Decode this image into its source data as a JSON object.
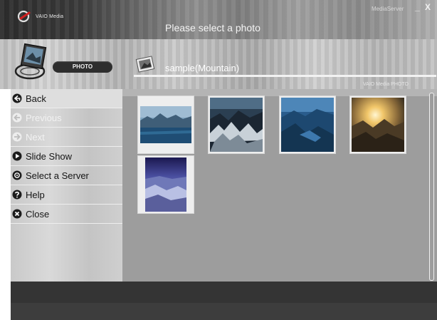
{
  "app": {
    "logo_text": "VAIO Media",
    "header_title": "Please select a photo",
    "server_label": "MediaServer",
    "window_controls": "_ X"
  },
  "category": {
    "pill_label": "PHOTO",
    "icon": "photo-camera-icon"
  },
  "album": {
    "title": "sample(Mountain)",
    "icon": "photo-album-icon",
    "source_label": "VAIO Media PHOTO"
  },
  "nav": {
    "items": [
      {
        "label": "Back",
        "icon": "back-arrow-icon",
        "enabled": true
      },
      {
        "label": "Previous",
        "icon": "previous-arrow-icon",
        "enabled": false
      },
      {
        "label": "Next",
        "icon": "next-arrow-icon",
        "enabled": false
      },
      {
        "label": "Slide Show",
        "icon": "play-icon",
        "enabled": true
      },
      {
        "label": "Select a Server",
        "icon": "server-icon",
        "enabled": true
      },
      {
        "label": "Help",
        "icon": "help-icon",
        "enabled": true
      },
      {
        "label": "Close",
        "icon": "close-icon",
        "enabled": true
      }
    ]
  },
  "thumbnails": [
    {
      "subject": "mountain-lake-thumbnail"
    },
    {
      "subject": "snowy-ridge-thumbnail"
    },
    {
      "subject": "mountain-valley-thumbnail"
    },
    {
      "subject": "mountain-sunset-thumbnail"
    },
    {
      "subject": "snow-field-thumbnail"
    }
  ],
  "colors": {
    "panel_bg": "#9d9d9d",
    "nav_text": "#151515",
    "nav_disabled_text": "#f2f2f2",
    "bottom_bar": "#343434"
  }
}
